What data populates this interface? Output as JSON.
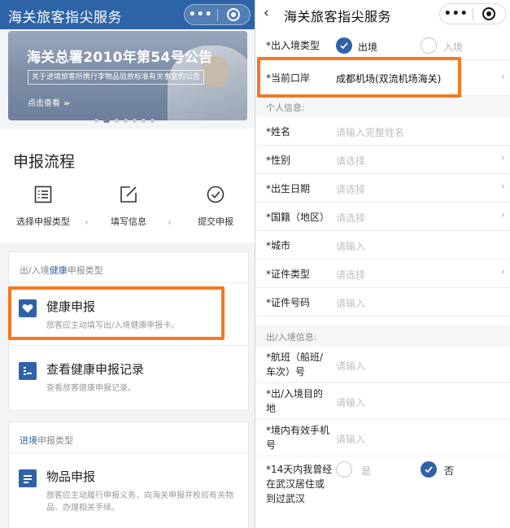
{
  "left": {
    "nav_title": "海关旅客指尖服务",
    "capsule_dots": "•••",
    "banner": {
      "title": "海关总署2010年第54号公告",
      "subtitle": "关于进境旅客所携行李物品验放标准有关事宜的公告",
      "link": "点击查看",
      "link_arrows": "›››",
      "page_count": 7,
      "active_page": 1
    },
    "flow": {
      "title": "申报流程",
      "steps": [
        {
          "label": "选择申报类型",
          "icon": "list-icon"
        },
        {
          "label": "填写信息",
          "icon": "edit-icon"
        },
        {
          "label": "提交申报",
          "icon": "check-circle-icon"
        }
      ]
    },
    "section_health": {
      "head_prefix": "出/入境",
      "head_accent": "健康",
      "head_suffix": "申报类型",
      "items": [
        {
          "title": "健康申报",
          "desc": "旅客应主动填写出/入境健康申报卡。",
          "icon": "heart-icon"
        },
        {
          "title": "查看健康申报记录",
          "desc": "查看旅客健康申报记录。",
          "icon": "record-list-icon"
        }
      ]
    },
    "section_entry": {
      "head_accent": "进境",
      "head_suffix": "申报类型",
      "items": [
        {
          "title": "物品申报",
          "desc": "旅客应主动履行申报义务，向海关申报并校验有关物品、办理相关手续。",
          "icon": "document-icon"
        }
      ]
    }
  },
  "right": {
    "nav_title": "海关旅客指尖服务",
    "back_glyph": "‹",
    "capsule_dots": "•••",
    "direction": {
      "label": "*出入境类型",
      "options": [
        {
          "label": "出境",
          "checked": true
        },
        {
          "label": "入境",
          "checked": false
        }
      ]
    },
    "port": {
      "label": "*当前口岸",
      "value": "成都机场(双流机场海关)"
    },
    "personal_head": "个人信息:",
    "personal": [
      {
        "label": "*姓名",
        "placeholder": "请输入完整姓名",
        "chevron": false
      },
      {
        "label": "*性别",
        "placeholder": "请选择",
        "chevron": true
      },
      {
        "label": "*出生日期",
        "placeholder": "请选择",
        "chevron": true
      },
      {
        "label": "*国籍（地区）",
        "placeholder": "请选择",
        "chevron": true
      },
      {
        "label": "*城市",
        "placeholder": "请输入",
        "chevron": false
      },
      {
        "label": "*证件类型",
        "placeholder": "请选择",
        "chevron": true
      },
      {
        "label": "*证件号码",
        "placeholder": "请输入",
        "chevron": false
      }
    ],
    "trip_head": "出/入境信息:",
    "trip": [
      {
        "label_1": "*航班（船班/",
        "label_2": "车次）号",
        "placeholder": "请输入"
      },
      {
        "label_1": "*出/入境目的",
        "label_2": "地",
        "placeholder": "请输入"
      },
      {
        "label_1": "*境内有效手机",
        "label_2": "号",
        "placeholder": "请输入"
      }
    ],
    "wuhan": {
      "label_1": "*14天内我曾经",
      "label_2": "在武汉居住或",
      "label_3": "到过武汉",
      "options": [
        {
          "label": "是",
          "checked": false
        },
        {
          "label": "否",
          "checked": true
        }
      ]
    }
  },
  "colors": {
    "primary": "#2e63a8",
    "highlight": "#f47920",
    "placeholder": "#c0c0c0"
  }
}
